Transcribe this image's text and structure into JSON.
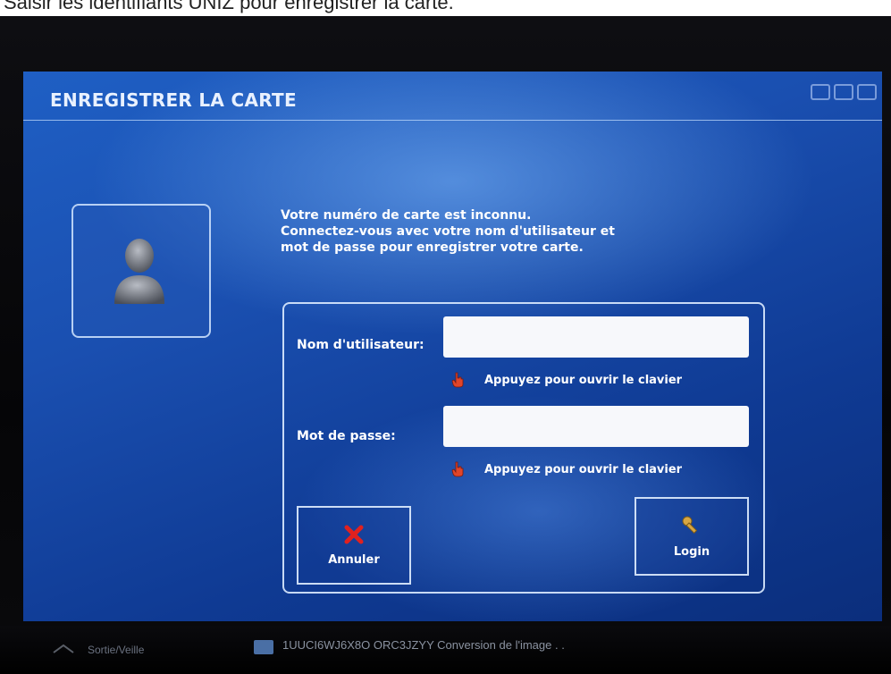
{
  "caption": "Saisir les identifiants UNIZ pour enregistrer la carte.",
  "header": {
    "title": "ENREGISTRER LA CARTE"
  },
  "message": {
    "line1": "Votre numéro de carte est inconnu.",
    "line2": "Connectez-vous avec votre nom d'utilisateur et",
    "line3": "mot de passe pour enregistrer votre carte."
  },
  "form": {
    "username_label": "Nom d'utilisateur:",
    "username_value": "",
    "password_label": "Mot de passe:",
    "password_value": "",
    "keyboard_hint": "Appuyez pour ouvrir le clavier"
  },
  "buttons": {
    "cancel": "Annuler",
    "login": "Login"
  },
  "taskbar": {
    "item1": "Sortie/Veille",
    "item2": "1UUCI6WJ6X8O ORC3JZYY Conversion de l'image . ."
  },
  "colors": {
    "screen_bg": "#1a4fb0",
    "cancel_icon": "#e0211f",
    "login_icon": "#d8a642",
    "hand_icon": "#e0452a"
  },
  "icons": {
    "avatar": "user-silhouette-icon",
    "hint": "pointing-hand-icon",
    "cancel": "red-x-icon",
    "login": "key-icon"
  }
}
